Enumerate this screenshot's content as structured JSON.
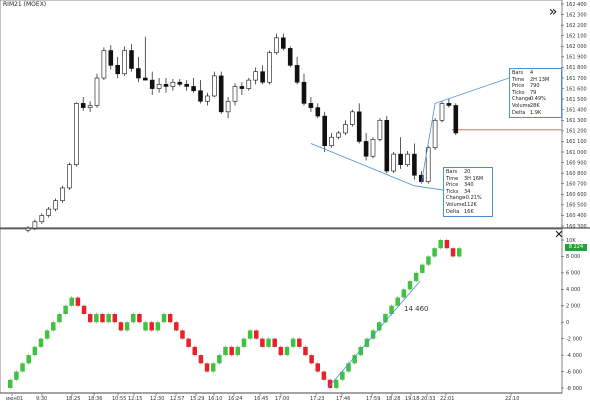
{
  "window": {
    "title": "RIM21 (MOEX)"
  },
  "toolbar": {
    "forward_icon": "double-chevron-right-icon",
    "close_icon": "close-icon"
  },
  "price_axis": {
    "labels": [
      "162 400",
      "162 300",
      "162 200",
      "162 100",
      "162 000",
      "161 900",
      "161 800",
      "161 700",
      "161 600",
      "161 500",
      "161 400",
      "161 300",
      "161 200",
      "161 100",
      "161 000",
      "160 900",
      "160 800",
      "160 700",
      "160 600",
      "160 500",
      "160 400",
      "160 300"
    ]
  },
  "indicator_axis": {
    "labels": [
      "10K",
      "8 000",
      "6 000",
      "4 000",
      "2 000",
      "0",
      "-2 000",
      "-4 000",
      "-6 000",
      "-8 000"
    ],
    "current_value": "8 224"
  },
  "time_axis": {
    "labels": [
      "июн01",
      "9:30",
      "18:25",
      "18:36",
      "10:55",
      "12:15",
      "12:30",
      "12:57",
      "15:29",
      "16:10",
      "16:24",
      "16:45",
      "17:00",
      "17:23",
      "17:46",
      "17:59",
      "18:28",
      "19:18",
      "20:33",
      "22:01",
      "22:10"
    ]
  },
  "info_box_upper": {
    "rows": [
      {
        "key": "Bars",
        "value": "4"
      },
      {
        "key": "Time",
        "value": "2Н 13М"
      },
      {
        "key": "Price",
        "value": "790"
      },
      {
        "key": "Ticks",
        "value": "79"
      },
      {
        "key": "Change",
        "value": "0.49%"
      },
      {
        "key": "Volume",
        "value": "28K"
      },
      {
        "key": "Delta",
        "value": "1.9K"
      }
    ]
  },
  "info_box_lower": {
    "rows": [
      {
        "key": "Bars",
        "value": "20"
      },
      {
        "key": "Time",
        "value": "3Н 16М"
      },
      {
        "key": "Price",
        "value": "340"
      },
      {
        "key": "Ticks",
        "value": "34"
      },
      {
        "key": "Change",
        "value": "-0.21%"
      },
      {
        "key": "Volume",
        "value": "112K"
      },
      {
        "key": "Delta",
        "value": "16K"
      }
    ]
  },
  "annotation": {
    "text": "14 460"
  },
  "colors": {
    "up": "#3fc23f",
    "down": "#e8202a",
    "measure_line": "#4a90d9",
    "level_line": "#e05050",
    "current_value_bg": "#22a33a"
  },
  "chart_data": {
    "type": "candlestick",
    "price_candles": [
      {
        "o": 160260,
        "h": 160300,
        "l": 160240,
        "c": 160280
      },
      {
        "o": 160280,
        "h": 160360,
        "l": 160260,
        "c": 160340
      },
      {
        "o": 160340,
        "h": 160420,
        "l": 160320,
        "c": 160400
      },
      {
        "o": 160400,
        "h": 160480,
        "l": 160380,
        "c": 160460
      },
      {
        "o": 160460,
        "h": 160560,
        "l": 160440,
        "c": 160540
      },
      {
        "o": 160540,
        "h": 160680,
        "l": 160520,
        "c": 160660
      },
      {
        "o": 160660,
        "h": 160900,
        "l": 160640,
        "c": 160880
      },
      {
        "o": 160880,
        "h": 161470,
        "l": 160860,
        "c": 161460
      },
      {
        "o": 161460,
        "h": 161520,
        "l": 161390,
        "c": 161420
      },
      {
        "o": 161420,
        "h": 161480,
        "l": 161380,
        "c": 161440
      },
      {
        "o": 161440,
        "h": 161740,
        "l": 161420,
        "c": 161700
      },
      {
        "o": 161700,
        "h": 161990,
        "l": 161680,
        "c": 161960
      },
      {
        "o": 161960,
        "h": 162010,
        "l": 161780,
        "c": 161820
      },
      {
        "o": 161820,
        "h": 161900,
        "l": 161700,
        "c": 161740
      },
      {
        "o": 161740,
        "h": 162000,
        "l": 161720,
        "c": 161960
      },
      {
        "o": 161960,
        "h": 162020,
        "l": 161760,
        "c": 161790
      },
      {
        "o": 161790,
        "h": 161900,
        "l": 161660,
        "c": 161700
      },
      {
        "o": 161700,
        "h": 162090,
        "l": 161690,
        "c": 161680
      },
      {
        "o": 161680,
        "h": 161760,
        "l": 161540,
        "c": 161600
      },
      {
        "o": 161600,
        "h": 161700,
        "l": 161560,
        "c": 161640
      },
      {
        "o": 161640,
        "h": 161700,
        "l": 161560,
        "c": 161620
      },
      {
        "o": 161620,
        "h": 161690,
        "l": 161580,
        "c": 161660
      },
      {
        "o": 161660,
        "h": 161690,
        "l": 161620,
        "c": 161640
      },
      {
        "o": 161640,
        "h": 161680,
        "l": 161580,
        "c": 161620
      },
      {
        "o": 161620,
        "h": 161700,
        "l": 161560,
        "c": 161580
      },
      {
        "o": 161580,
        "h": 161680,
        "l": 161460,
        "c": 161480
      },
      {
        "o": 161480,
        "h": 161560,
        "l": 161440,
        "c": 161530
      },
      {
        "o": 161530,
        "h": 161760,
        "l": 161520,
        "c": 161720
      },
      {
        "o": 161720,
        "h": 161760,
        "l": 161360,
        "c": 161380
      },
      {
        "o": 161380,
        "h": 161520,
        "l": 161320,
        "c": 161480
      },
      {
        "o": 161480,
        "h": 161650,
        "l": 161440,
        "c": 161620
      },
      {
        "o": 161620,
        "h": 161660,
        "l": 161540,
        "c": 161600
      },
      {
        "o": 161600,
        "h": 161700,
        "l": 161580,
        "c": 161680
      },
      {
        "o": 161680,
        "h": 161800,
        "l": 161640,
        "c": 161760
      },
      {
        "o": 161760,
        "h": 161820,
        "l": 161640,
        "c": 161660
      },
      {
        "o": 161660,
        "h": 161960,
        "l": 161640,
        "c": 161940
      },
      {
        "o": 161940,
        "h": 162120,
        "l": 161920,
        "c": 162080
      },
      {
        "o": 162080,
        "h": 162120,
        "l": 161960,
        "c": 161980
      },
      {
        "o": 161980,
        "h": 162000,
        "l": 161800,
        "c": 161820
      },
      {
        "o": 161820,
        "h": 161900,
        "l": 161640,
        "c": 161660
      },
      {
        "o": 161660,
        "h": 161740,
        "l": 161440,
        "c": 161460
      },
      {
        "o": 161460,
        "h": 161520,
        "l": 161380,
        "c": 161420
      },
      {
        "o": 161420,
        "h": 161460,
        "l": 161320,
        "c": 161340
      },
      {
        "o": 161340,
        "h": 161380,
        "l": 161000,
        "c": 161060
      },
      {
        "o": 161060,
        "h": 161180,
        "l": 161040,
        "c": 161140
      },
      {
        "o": 161140,
        "h": 161200,
        "l": 161120,
        "c": 161180
      },
      {
        "o": 161180,
        "h": 161300,
        "l": 161160,
        "c": 161260
      },
      {
        "o": 161260,
        "h": 161400,
        "l": 161240,
        "c": 161380
      },
      {
        "o": 161380,
        "h": 161460,
        "l": 161080,
        "c": 161100
      },
      {
        "o": 161100,
        "h": 161180,
        "l": 160920,
        "c": 160960
      },
      {
        "o": 160960,
        "h": 161140,
        "l": 160940,
        "c": 161120
      },
      {
        "o": 161120,
        "h": 161320,
        "l": 161100,
        "c": 161300
      },
      {
        "o": 161300,
        "h": 161340,
        "l": 160800,
        "c": 160820
      },
      {
        "o": 160820,
        "h": 161000,
        "l": 160800,
        "c": 160980
      },
      {
        "o": 160980,
        "h": 161140,
        "l": 160840,
        "c": 160880
      },
      {
        "o": 160880,
        "h": 161010,
        "l": 160860,
        "c": 160980
      },
      {
        "o": 160980,
        "h": 161080,
        "l": 160740,
        "c": 160780
      },
      {
        "o": 160780,
        "h": 160820,
        "l": 160700,
        "c": 160720
      },
      {
        "o": 160720,
        "h": 161060,
        "l": 160700,
        "c": 161040
      },
      {
        "o": 161040,
        "h": 161320,
        "l": 161020,
        "c": 161300
      },
      {
        "o": 161300,
        "h": 161480,
        "l": 161280,
        "c": 161460
      },
      {
        "o": 161460,
        "h": 161500,
        "l": 161420,
        "c": 161440
      },
      {
        "o": 161440,
        "h": 161460,
        "l": 161160,
        "c": 161180
      }
    ],
    "level_line": 161210,
    "indicator_bricks": [
      {
        "v": -7000,
        "up": true
      },
      {
        "v": -6000,
        "up": true
      },
      {
        "v": -5000,
        "up": true
      },
      {
        "v": -4000,
        "up": true
      },
      {
        "v": -3000,
        "up": true
      },
      {
        "v": -2000,
        "up": true
      },
      {
        "v": -1000,
        "up": true
      },
      {
        "v": 0,
        "up": true
      },
      {
        "v": 1000,
        "up": true
      },
      {
        "v": 2000,
        "up": true
      },
      {
        "v": 3000,
        "up": true
      },
      {
        "v": 2000,
        "up": false
      },
      {
        "v": 1000,
        "up": false
      },
      {
        "v": 0,
        "up": false
      },
      {
        "v": 1000,
        "up": true
      },
      {
        "v": 0,
        "up": false
      },
      {
        "v": 1000,
        "up": true
      },
      {
        "v": 0,
        "up": false
      },
      {
        "v": -1000,
        "up": false
      },
      {
        "v": 0,
        "up": true
      },
      {
        "v": 1000,
        "up": true
      },
      {
        "v": 0,
        "up": false
      },
      {
        "v": 0,
        "up": true
      },
      {
        "v": -1000,
        "up": false
      },
      {
        "v": 0,
        "up": true
      },
      {
        "v": 1000,
        "up": true
      },
      {
        "v": 0,
        "up": false
      },
      {
        "v": -1000,
        "up": false
      },
      {
        "v": -2000,
        "up": false
      },
      {
        "v": -3000,
        "up": false
      },
      {
        "v": -4000,
        "up": false
      },
      {
        "v": -5000,
        "up": false
      },
      {
        "v": -6000,
        "up": false
      },
      {
        "v": -5000,
        "up": true
      },
      {
        "v": -4000,
        "up": true
      },
      {
        "v": -3000,
        "up": true
      },
      {
        "v": -4000,
        "up": false
      },
      {
        "v": -3000,
        "up": true
      },
      {
        "v": -2000,
        "up": true
      },
      {
        "v": -1000,
        "up": true
      },
      {
        "v": -2000,
        "up": false
      },
      {
        "v": -3000,
        "up": false
      },
      {
        "v": -2000,
        "up": true
      },
      {
        "v": -3000,
        "up": false
      },
      {
        "v": -4000,
        "up": false
      },
      {
        "v": -3000,
        "up": true
      },
      {
        "v": -2000,
        "up": true
      },
      {
        "v": -3000,
        "up": false
      },
      {
        "v": -4000,
        "up": false
      },
      {
        "v": -5000,
        "up": false
      },
      {
        "v": -6000,
        "up": false
      },
      {
        "v": -7000,
        "up": false
      },
      {
        "v": -8000,
        "up": false
      },
      {
        "v": -7000,
        "up": true
      },
      {
        "v": -6000,
        "up": true
      },
      {
        "v": -5000,
        "up": true
      },
      {
        "v": -4000,
        "up": true
      },
      {
        "v": -3000,
        "up": true
      },
      {
        "v": -2000,
        "up": true
      },
      {
        "v": -1000,
        "up": true
      },
      {
        "v": 0,
        "up": true
      },
      {
        "v": 1000,
        "up": true
      },
      {
        "v": 2000,
        "up": true
      },
      {
        "v": 3000,
        "up": true
      },
      {
        "v": 4000,
        "up": true
      },
      {
        "v": 5000,
        "up": true
      },
      {
        "v": 6000,
        "up": true
      },
      {
        "v": 7000,
        "up": true
      },
      {
        "v": 8000,
        "up": true
      },
      {
        "v": 9000,
        "up": true
      },
      {
        "v": 10000,
        "up": true
      },
      {
        "v": 9000,
        "up": false
      },
      {
        "v": 8000,
        "up": false
      },
      {
        "v": 9000,
        "up": true
      }
    ]
  }
}
